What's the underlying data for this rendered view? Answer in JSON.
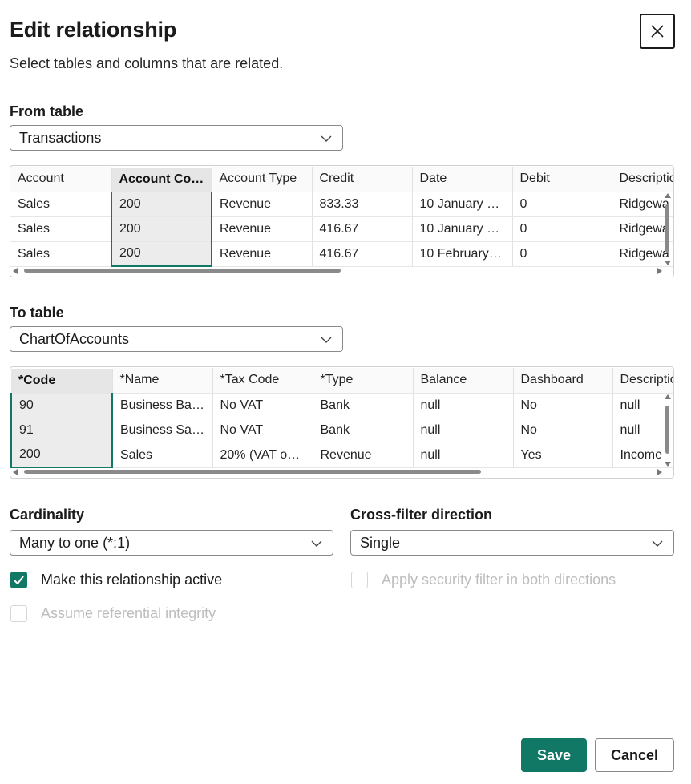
{
  "dialog": {
    "title": "Edit relationship",
    "subtitle": "Select tables and columns that are related.",
    "close_icon": "close-icon"
  },
  "from": {
    "label": "From table",
    "selected": "Transactions",
    "columns": [
      "Account",
      "Account Code",
      "Account Type",
      "Credit",
      "Date",
      "Debit",
      "Descriptio"
    ],
    "selected_column": "Account Code",
    "rows": [
      [
        "Sales",
        "200",
        "Revenue",
        "833.33",
        "10 January 20...",
        "0",
        "Ridgewa"
      ],
      [
        "Sales",
        "200",
        "Revenue",
        "416.67",
        "10 January 20...",
        "0",
        "Ridgewa"
      ],
      [
        "Sales",
        "200",
        "Revenue",
        "416.67",
        "10 February 2...",
        "0",
        "Ridgewa"
      ]
    ]
  },
  "to": {
    "label": "To table",
    "selected": "ChartOfAccounts",
    "columns": [
      "*Code",
      "*Name",
      "*Tax Code",
      "*Type",
      "Balance",
      "Dashboard",
      "Descriptio"
    ],
    "selected_column": "*Code",
    "rows": [
      [
        "90",
        "Business Bank...",
        "No VAT",
        "Bank",
        "null",
        "No",
        "null"
      ],
      [
        "91",
        "Business Savi...",
        "No VAT",
        "Bank",
        "null",
        "No",
        "null"
      ],
      [
        "200",
        "Sales",
        "20% (VAT on I...",
        "Revenue",
        "null",
        "Yes",
        "Income"
      ]
    ]
  },
  "cardinality": {
    "label": "Cardinality",
    "selected": "Many to one (*:1)"
  },
  "crossfilter": {
    "label": "Cross-filter direction",
    "selected": "Single"
  },
  "options": {
    "active": {
      "label": "Make this relationship active",
      "checked": true
    },
    "security": {
      "label": "Apply security filter in both directions",
      "checked": false,
      "disabled": true
    },
    "integrity": {
      "label": "Assume referential integrity",
      "checked": false,
      "disabled": true
    }
  },
  "buttons": {
    "save": "Save",
    "cancel": "Cancel"
  },
  "colors": {
    "accent": "#117865"
  }
}
